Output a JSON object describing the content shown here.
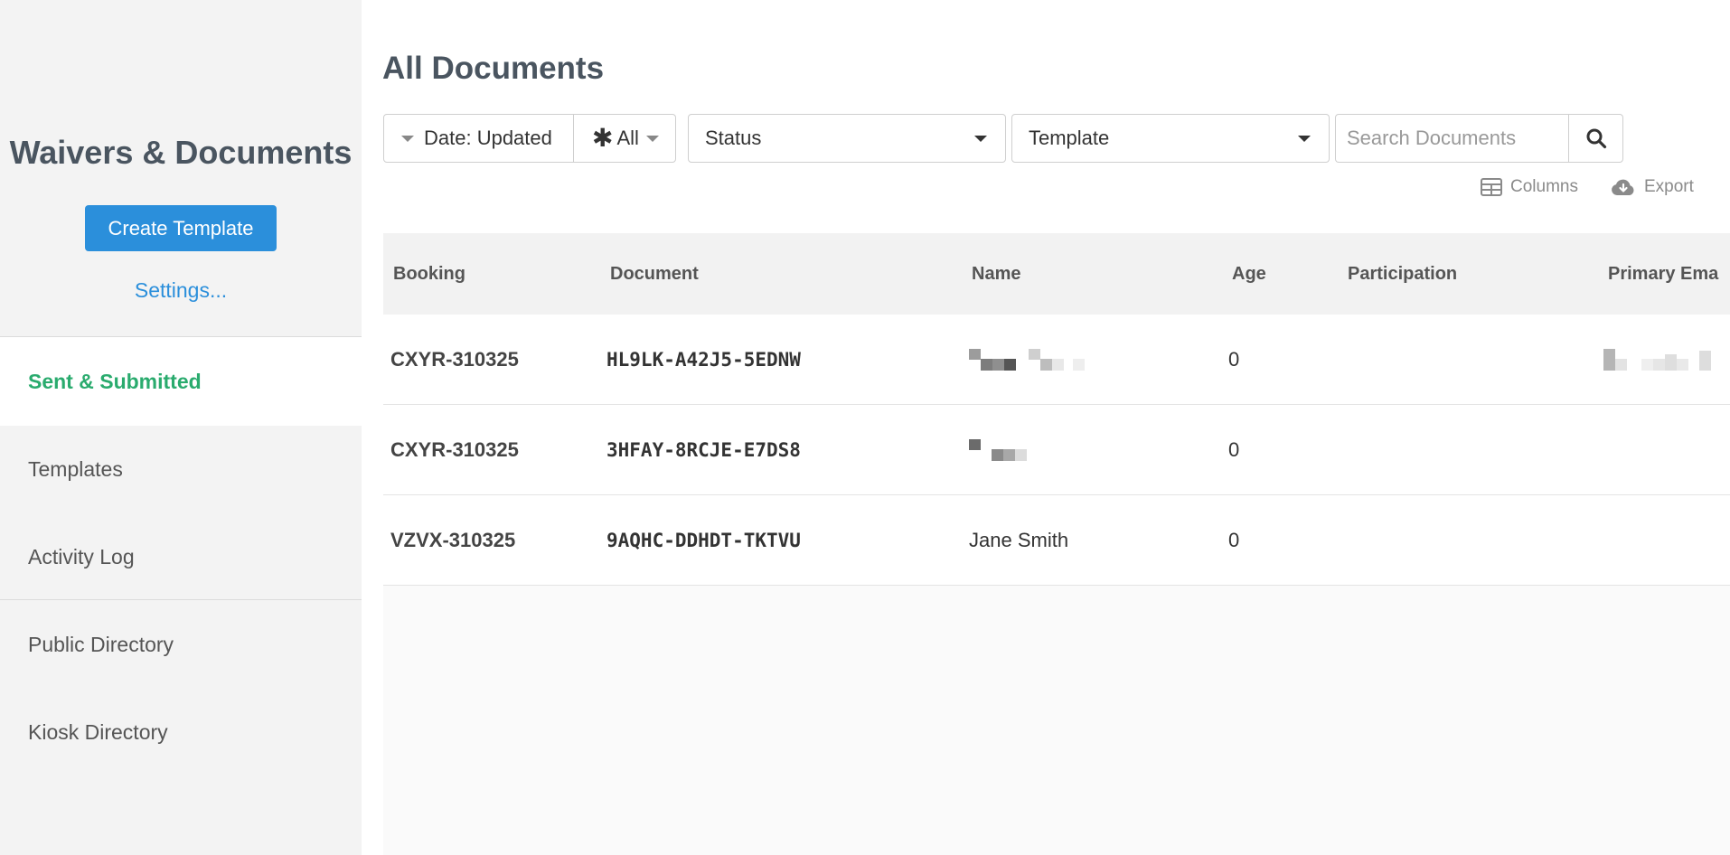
{
  "sidebar": {
    "title": "Waivers & Documents",
    "create_label": "Create Template",
    "settings_label": "Settings...",
    "items": [
      {
        "label": "Sent & Submitted",
        "active": true
      },
      {
        "label": "Templates"
      },
      {
        "label": "Activity Log"
      },
      {
        "label": "Public Directory"
      },
      {
        "label": "Kiosk Directory"
      }
    ]
  },
  "main": {
    "title": "All Documents",
    "filters": {
      "date": "Date: Updated",
      "range": "All",
      "status": "Status",
      "template": "Template"
    },
    "search": {
      "placeholder": "Search Documents",
      "value": ""
    },
    "tools": {
      "columns": "Columns",
      "export": "Export"
    },
    "table": {
      "columns": [
        "Booking",
        "Document",
        "Name",
        "Age",
        "Participation",
        "Primary Ema"
      ],
      "rows": [
        {
          "booking": "CXYR-310325",
          "document": "HL9LK-A42J5-5EDNW",
          "name": "",
          "age": "0",
          "participation": "",
          "email": ""
        },
        {
          "booking": "CXYR-310325",
          "document": "3HFAY-8RCJE-E7DS8",
          "name": "",
          "age": "0",
          "participation": "",
          "email": ""
        },
        {
          "booking": "VZVX-310325",
          "document": "9AQHC-DDHDT-TKTVU",
          "name": "Jane Smith",
          "age": "0",
          "participation": "",
          "email": ""
        }
      ]
    }
  },
  "colors": {
    "accent": "#2b8fdb",
    "active_nav": "#2aab6e",
    "title": "#4a5560"
  }
}
